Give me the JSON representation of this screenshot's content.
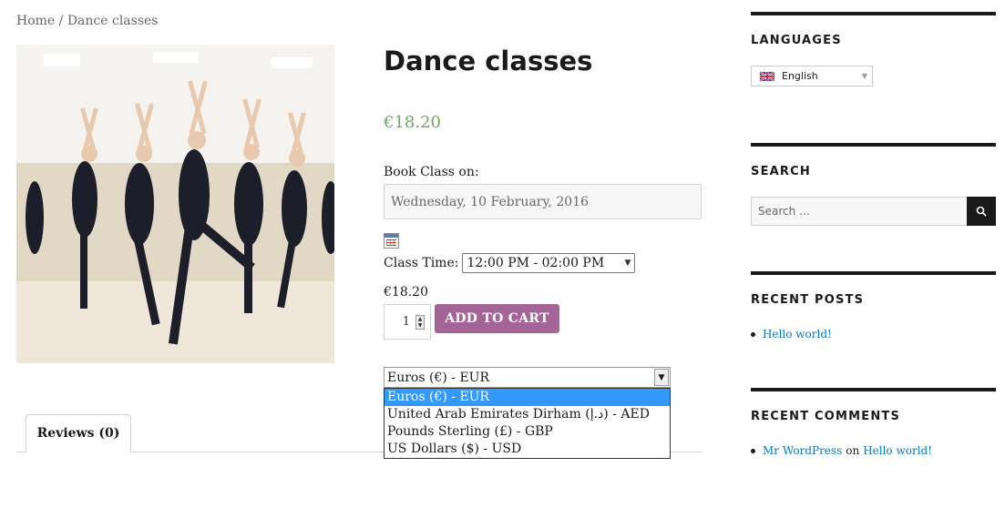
{
  "breadcrumb": {
    "home": "Home",
    "separator": " / ",
    "current": "Dance classes"
  },
  "product": {
    "title": "Dance classes",
    "price": "€18.20",
    "book_label": "Book Class on:",
    "date_value": "Wednesday, 10 February, 2016",
    "time_label": "Class Time:",
    "time_value": "12:00 PM - 02:00 PM",
    "price_small": "€18.20",
    "quantity": "1",
    "add_to_cart": "ADD TO CART"
  },
  "currency": {
    "selected": "Euros (€) - EUR",
    "options": [
      "Euros (€) - EUR",
      "United Arab Emirates Dirham (د.إ) - AED",
      "Pounds Sterling (£) - GBP",
      "US Dollars ($) - USD"
    ]
  },
  "tabs": {
    "reviews": "Reviews (0)"
  },
  "sidebar": {
    "languages": {
      "title": "LANGUAGES",
      "selected": "English",
      "flag_icon": "uk-flag-icon"
    },
    "search": {
      "title": "SEARCH",
      "placeholder": "Search …",
      "icon": "search-icon"
    },
    "recent_posts": {
      "title": "RECENT POSTS",
      "items": [
        "Hello world!"
      ]
    },
    "recent_comments": {
      "title": "RECENT COMMENTS",
      "author": "Mr WordPress",
      "on": "on",
      "post": "Hello world!"
    }
  },
  "colors": {
    "price_green": "#77a464",
    "button_purple": "#a46497",
    "link_blue": "#007acc",
    "selection_blue": "#3399ff"
  }
}
